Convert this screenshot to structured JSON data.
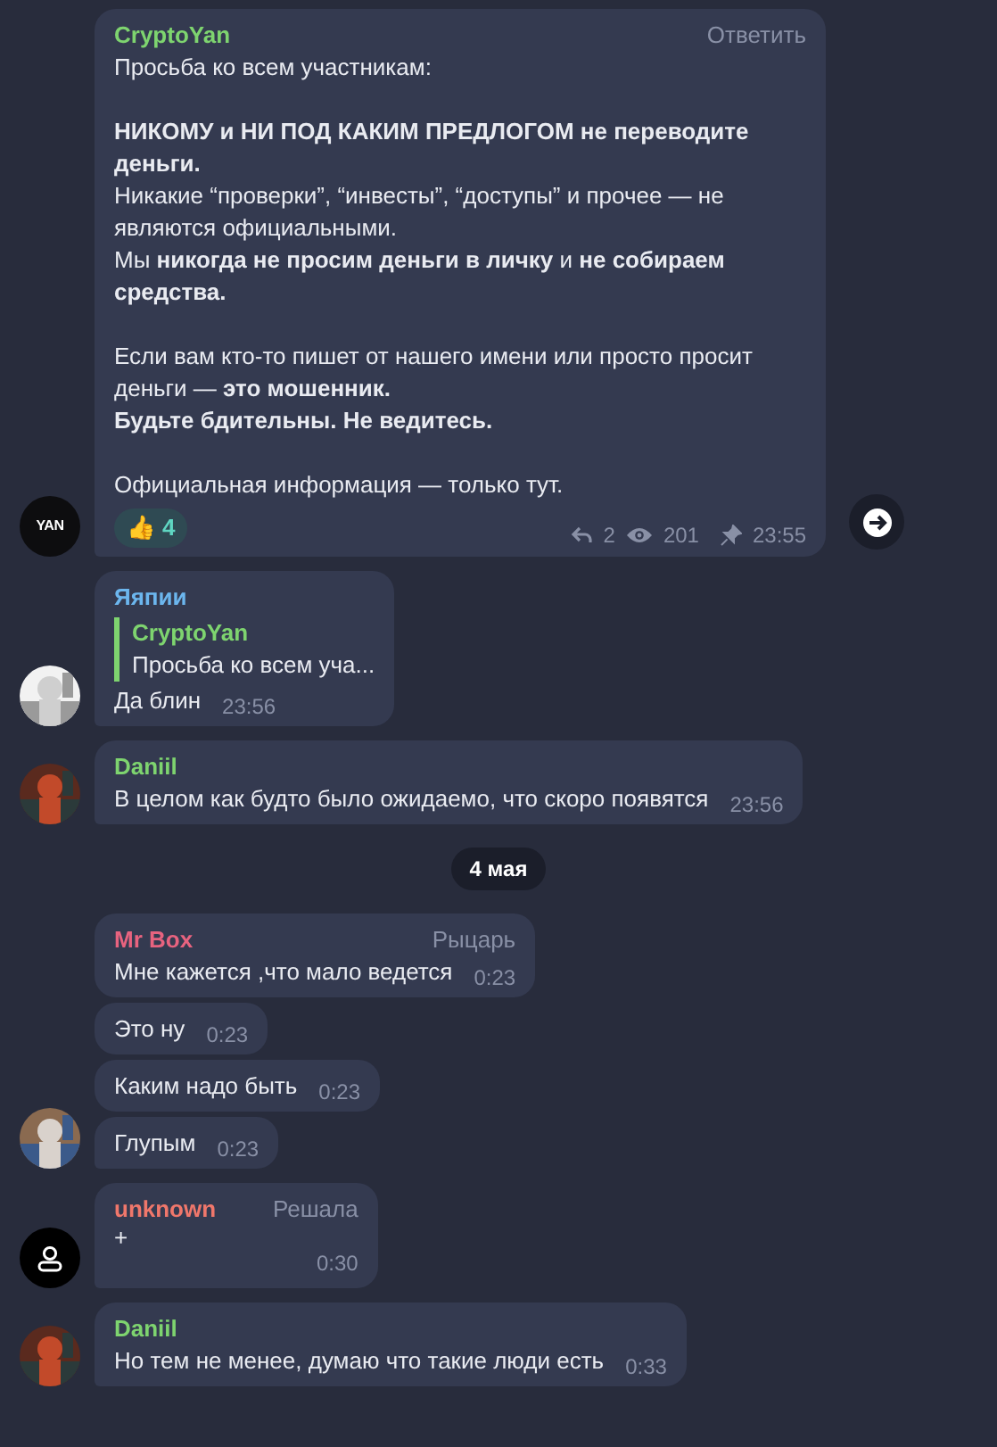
{
  "messages": [
    {
      "kind": "group",
      "avatar": {
        "kind": "logo",
        "text": "YAN"
      },
      "share_button": true,
      "bubbles": [
        {
          "sender": "CryptoYan",
          "color": "#7ed46f",
          "role": "Ответить",
          "paragraphs": [
            [
              {
                "text": "Просьба ко всем участникам:",
                "bold": false
              }
            ],
            [
              {
                "text": "НИКОМУ и НИ ПОД КАКИМ ПРЕДЛОГОМ не переводите деньги.",
                "bold": true
              },
              {
                "text": "Никакие “проверки”, “инвесты”, “доступы” и прочее — не являются официальными.",
                "bold": false
              },
              {
                "text": "Мы **никогда не просим деньги в личку** и **не собираем средства.**",
                "bold": false
              }
            ],
            [
              {
                "text": "Если вам кто-то пишет от нашего имени или просто просит деньги — **это мошенник.**",
                "bold": false
              },
              {
                "text": "Будьте бдительны. Не ведитесь.",
                "bold": true
              }
            ],
            [
              {
                "text": "Официальная информация — только тут.",
                "bold": false
              }
            ]
          ],
          "reactions": [
            {
              "emoji": "👍",
              "count": "4"
            }
          ],
          "replies": "2",
          "views": "201",
          "pinned": true,
          "time": "23:55"
        }
      ]
    },
    {
      "kind": "group",
      "avatar": {
        "kind": "picture"
      },
      "share_button": false,
      "bubbles": [
        {
          "sender": "Яяпии",
          "color": "#6cb6ee",
          "quote": {
            "sender": "CryptoYan",
            "text": "Просьба ко всем уча...",
            "color": "#7ed46f"
          },
          "paragraphs": [
            [
              {
                "text": "Да блин",
                "bold": false
              }
            ]
          ],
          "time": "23:56"
        }
      ]
    },
    {
      "kind": "group",
      "avatar": {
        "kind": "picture"
      },
      "share_button": false,
      "bubbles": [
        {
          "sender": "Daniil",
          "color": "#7ed46f",
          "paragraphs": [
            [
              {
                "text": "В целом как будто было ожидаемо, что скоро появятся",
                "bold": false
              }
            ]
          ],
          "time": "23:56"
        }
      ]
    },
    {
      "kind": "date",
      "text": "4 мая"
    },
    {
      "kind": "group",
      "avatar": {
        "kind": "picture"
      },
      "share_button": false,
      "bubbles": [
        {
          "sender": "Mr Box",
          "color": "#e8637f",
          "role": "Рыцарь",
          "paragraphs": [
            [
              {
                "text": "Мне кажется ,что мало ведется",
                "bold": false
              }
            ]
          ],
          "time": "0:23"
        },
        {
          "paragraphs": [
            [
              {
                "text": "Это ну",
                "bold": false
              }
            ]
          ],
          "time": "0:23"
        },
        {
          "paragraphs": [
            [
              {
                "text": "Каким надо быть",
                "bold": false
              }
            ]
          ],
          "time": "0:23"
        },
        {
          "paragraphs": [
            [
              {
                "text": "Глупым",
                "bold": false
              }
            ]
          ],
          "time": "0:23"
        }
      ]
    },
    {
      "kind": "group",
      "avatar": {
        "kind": "user-icon"
      },
      "share_button": false,
      "bubbles": [
        {
          "sender": "unknown",
          "color": "#f0776b",
          "role": "Решала",
          "paragraphs": [
            [
              {
                "text": "+",
                "bold": false
              }
            ]
          ],
          "time": "0:30",
          "time_below": true
        }
      ]
    },
    {
      "kind": "group",
      "avatar": {
        "kind": "picture"
      },
      "share_button": false,
      "bubbles": [
        {
          "sender": "Daniil",
          "color": "#7ed46f",
          "paragraphs": [
            [
              {
                "text": "Но тем не менее, думаю что такие люди есть",
                "bold": false
              }
            ]
          ],
          "time": "0:33"
        }
      ]
    }
  ]
}
